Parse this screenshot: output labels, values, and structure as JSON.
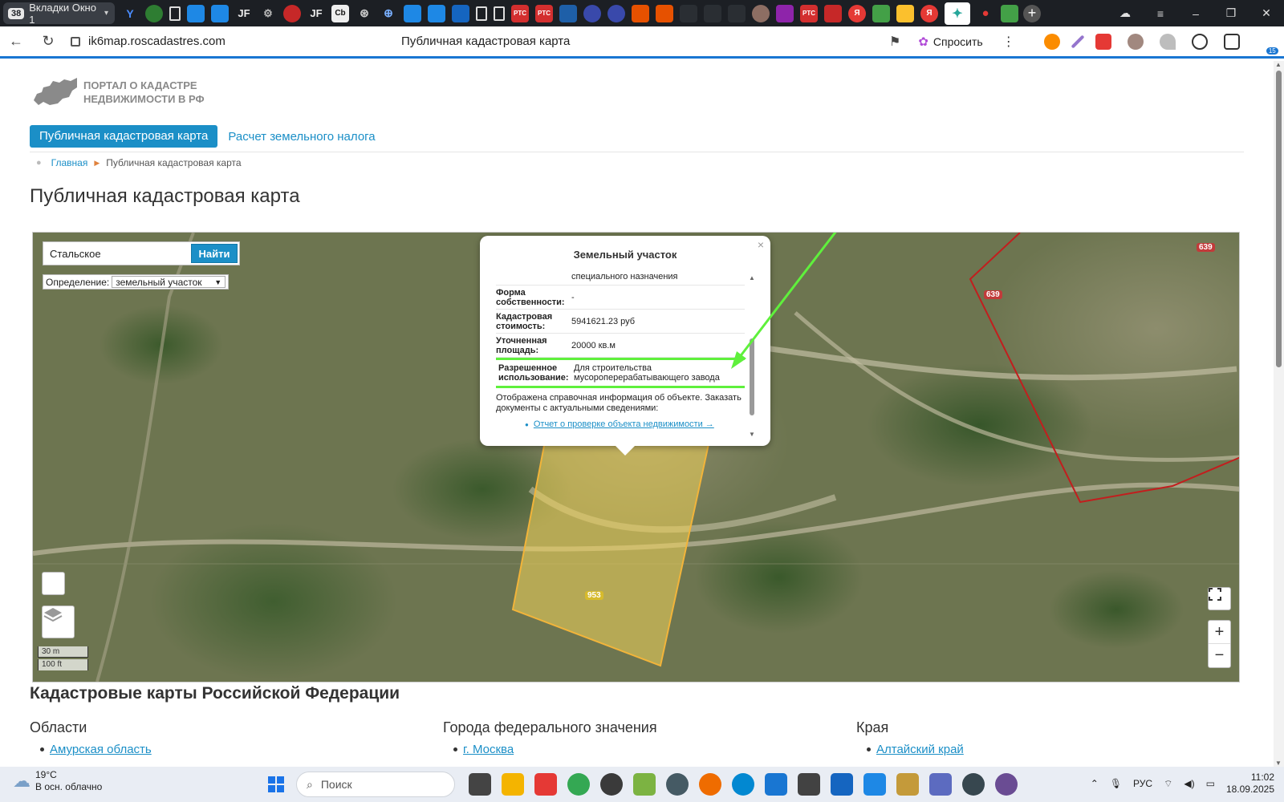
{
  "browser": {
    "tab_count": "38",
    "tab_group_label": "Вкладки Окно 1",
    "url": "ik6map.roscadastres.com",
    "page_title": "Публичная кадастровая карта",
    "ask_label": "Спросить",
    "notification_badge": "15",
    "pinned_tab_labels": [
      "JF",
      "JF",
      "Cb",
      "PTC",
      "PTC",
      "PTC",
      "Я",
      "Я"
    ]
  },
  "site": {
    "logo_line1": "Портал о кадастре",
    "logo_line2": "недвижимости в РФ",
    "nav": {
      "map_label": "Публичная кадастровая карта",
      "tax_label": "Расчет земельного налога"
    },
    "breadcrumb": {
      "home": "Главная",
      "current": "Публичная кадастровая карта"
    },
    "heading": "Публичная кадастровая карта"
  },
  "map": {
    "search_value": "Стальское",
    "search_button": "Найти",
    "definition_label": "Определение:",
    "definition_value": "земельный участок",
    "scale_m": "30 m",
    "scale_ft": "100 ft",
    "zoom_in": "+",
    "zoom_out": "−",
    "plot_labels": {
      "main": "953",
      "neighbor_a": "639",
      "neighbor_b": "639"
    },
    "colors": {
      "selected_plot": "#f2d35a",
      "neighbor_plot": "#c21e1e",
      "highlight": "#5ff03c"
    }
  },
  "popup": {
    "title": "Земельный участок",
    "close": "×",
    "cut_text": "специального назначения",
    "rows": [
      {
        "key": "Форма собственности:",
        "value": "-"
      },
      {
        "key": "Кадастровая стоимость:",
        "value": "5941621.23 руб"
      },
      {
        "key": "Уточненная площадь:",
        "value": "20000 кв.м"
      },
      {
        "key": "Разрешенное использование:",
        "value": "Для строительства мусороперерабатывающего завода"
      }
    ],
    "info": "Отображена справочная информация об объекте. Заказать документы с актуальными сведениями:",
    "report_link": "Отчет о проверке объекта недвижимости →"
  },
  "footer_section": {
    "heading": "Кадастровые карты Российской Федерации",
    "columns": [
      {
        "title": "Области",
        "first_link": "Амурская область"
      },
      {
        "title": "Города федерального значения",
        "first_link": "г. Москва"
      },
      {
        "title": "Края",
        "first_link": "Алтайский край"
      }
    ]
  },
  "taskbar": {
    "temperature": "19°C",
    "weather": "В осн. облачно",
    "search_placeholder": "Поиск",
    "language": "РУС",
    "time": "11:02",
    "date": "18.09.2025"
  }
}
